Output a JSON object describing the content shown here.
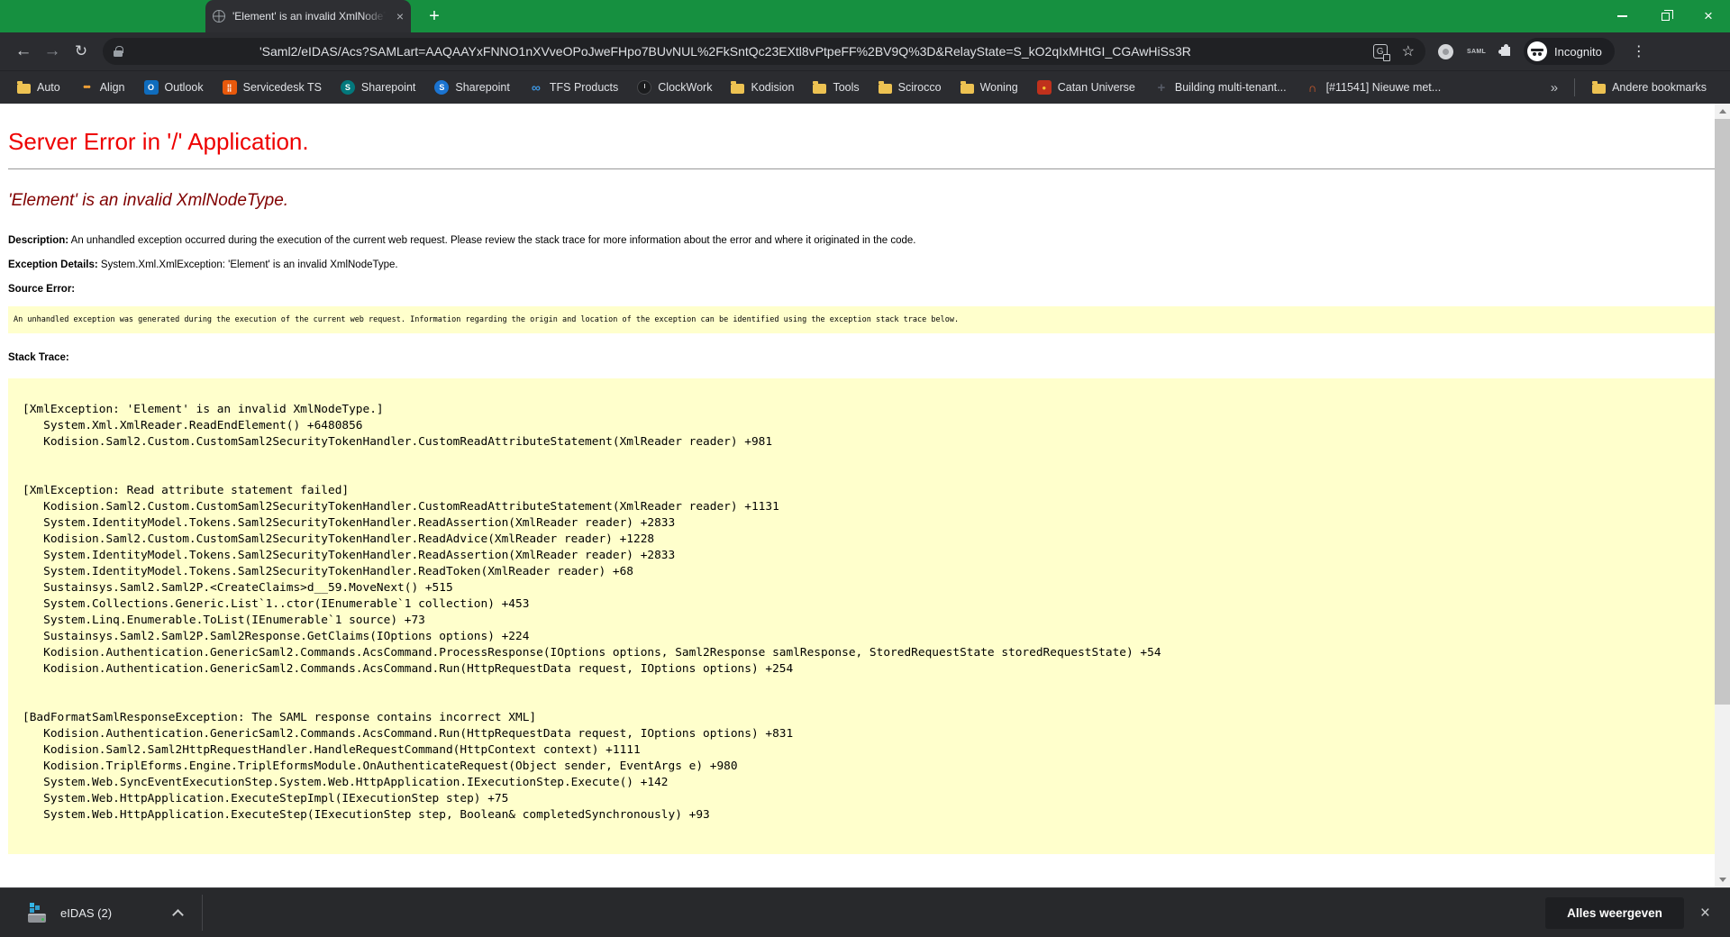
{
  "browser": {
    "tab": {
      "title": "'Element' is an invalid XmlNodeType"
    },
    "tab_close_glyph": "×",
    "new_tab_glyph": "+",
    "window_close_glyph": "×",
    "toolbar": {
      "back_glyph": "←",
      "forward_glyph": "→",
      "reload_glyph": "↻",
      "url": "'Saml2/eIDAS/Acs?SAMLart=AAQAAYxFNNO1nXVveOPoJweFHpo7BUvNUL%2FkSntQc23EXtl8vPtpeFF%2BV9Q%3D&RelayState=S_kO2qIxMHtGI_CGAwHiSs3R",
      "translate_glyph": "G",
      "star_glyph": "☆",
      "saml_extension_label": "SAML",
      "incognito_label": "Incognito",
      "menu_glyph": "⋮"
    },
    "theme_colors": {
      "frame_green": "#169040",
      "toolbar_bg": "#2b2c30",
      "omnibox_bg": "#202124"
    },
    "bookmarks_bar": {
      "items": [
        {
          "label": "Auto",
          "icon": "folder"
        },
        {
          "label": "Align",
          "icon": "dots",
          "glyph": "•••"
        },
        {
          "label": "Outlook",
          "icon": "outlook",
          "glyph": "O"
        },
        {
          "label": "Servicedesk TS",
          "icon": "grid",
          "glyph": "⣿"
        },
        {
          "label": "Sharepoint",
          "icon": "sp-teal",
          "glyph": "S"
        },
        {
          "label": "Sharepoint",
          "icon": "sp-blue",
          "glyph": "S"
        },
        {
          "label": "TFS Products",
          "icon": "tfs",
          "glyph": "∞"
        },
        {
          "label": "ClockWork",
          "icon": "clock"
        },
        {
          "label": "Kodision",
          "icon": "folder"
        },
        {
          "label": "Tools",
          "icon": "folder"
        },
        {
          "label": "Scirocco",
          "icon": "folder"
        },
        {
          "label": "Woning",
          "icon": "folder"
        },
        {
          "label": "Catan Universe",
          "icon": "catan",
          "glyph": "●"
        },
        {
          "label": "Building multi-tenant...",
          "icon": "plus-dark",
          "glyph": "+"
        },
        {
          "label": "[#11541] Nieuwe met...",
          "icon": "arc",
          "glyph": "∩"
        }
      ],
      "overflow_glyph": "»",
      "other_bookmarks_label": "Andere bookmarks"
    }
  },
  "page": {
    "title": "Server Error in '/' Application.",
    "subtitle": "'Element' is an invalid XmlNodeType.",
    "description_label": "Description:",
    "description_text": " An unhandled exception occurred during the execution of the current web request. Please review the stack trace for more information about the error and where it originated in the code.",
    "exception_label": "Exception Details:",
    "exception_text": " System.Xml.XmlException: 'Element' is an invalid XmlNodeType.",
    "source_error_label": "Source Error:",
    "source_error_note": "An unhandled exception was generated during the execution of the current web request. Information regarding the origin and location of the exception can be identified using the exception stack trace below.",
    "stack_trace_label": "Stack Trace:",
    "stack_trace": [
      "[XmlException: 'Element' is an invalid XmlNodeType.]",
      "   System.Xml.XmlReader.ReadEndElement() +6480856",
      "   Kodision.Saml2.Custom.CustomSaml2SecurityTokenHandler.CustomReadAttributeStatement(XmlReader reader) +981",
      "",
      "",
      "[XmlException: Read attribute statement failed]",
      "   Kodision.Saml2.Custom.CustomSaml2SecurityTokenHandler.CustomReadAttributeStatement(XmlReader reader) +1131",
      "   System.IdentityModel.Tokens.Saml2SecurityTokenHandler.ReadAssertion(XmlReader reader) +2833",
      "   Kodision.Saml2.Custom.CustomSaml2SecurityTokenHandler.ReadAdvice(XmlReader reader) +1228",
      "   System.IdentityModel.Tokens.Saml2SecurityTokenHandler.ReadAssertion(XmlReader reader) +2833",
      "   System.IdentityModel.Tokens.Saml2SecurityTokenHandler.ReadToken(XmlReader reader) +68",
      "   Sustainsys.Saml2.Saml2P.<CreateClaims>d__59.MoveNext() +515",
      "   System.Collections.Generic.List`1..ctor(IEnumerable`1 collection) +453",
      "   System.Linq.Enumerable.ToList(IEnumerable`1 source) +73",
      "   Sustainsys.Saml2.Saml2P.Saml2Response.GetClaims(IOptions options) +224",
      "   Kodision.Authentication.GenericSaml2.Commands.AcsCommand.ProcessResponse(IOptions options, Saml2Response samlResponse, StoredRequestState storedRequestState) +54",
      "   Kodision.Authentication.GenericSaml2.Commands.AcsCommand.Run(HttpRequestData request, IOptions options) +254",
      "",
      "",
      "[BadFormatSamlResponseException: The SAML response contains incorrect XML]",
      "   Kodision.Authentication.GenericSaml2.Commands.AcsCommand.Run(HttpRequestData request, IOptions options) +831",
      "   Kodision.Saml2.Saml2HttpRequestHandler.HandleRequestCommand(HttpContext context) +1111",
      "   Kodision.TriplEforms.Engine.TriplEformsModule.OnAuthenticateRequest(Object sender, EventArgs e) +980",
      "   System.Web.SyncEventExecutionStep.System.Web.HttpApplication.IExecutionStep.Execute() +142",
      "   System.Web.HttpApplication.ExecuteStepImpl(IExecutionStep step) +75",
      "   System.Web.HttpApplication.ExecuteStep(IExecutionStep step, Boolean& completedSynchronously) +93"
    ]
  },
  "download_bar": {
    "item_label": "eIDAS (2)",
    "show_all_label": "Alles weergeven",
    "close_glyph": "×"
  }
}
